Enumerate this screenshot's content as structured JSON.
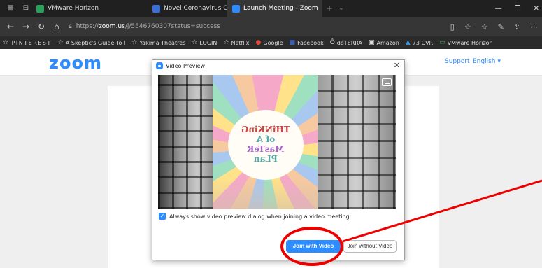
{
  "browser": {
    "tabs": [
      {
        "label": "VMware Horizon",
        "color": "#2aa05a"
      },
      {
        "label": "Novel Coronavirus Outbreal",
        "color": "#3a6fd8"
      },
      {
        "label": "Launch Meeting - Zoom",
        "color": "#2d8cff",
        "active": true
      }
    ],
    "url_prefix": "https://",
    "url_host": "zoom.us",
    "url_path": "/j/5546760307status=success",
    "favorites": [
      {
        "label": "PINTEREST",
        "icon": "star-icon"
      },
      {
        "label": "A Skeptic's Guide To I",
        "icon": "star-icon"
      },
      {
        "label": "Yakima Theatres",
        "icon": "star-icon"
      },
      {
        "label": "LOGIN",
        "icon": "star-icon"
      },
      {
        "label": "Netflix",
        "icon": "star-icon"
      },
      {
        "label": "Google",
        "icon": "google-icon"
      },
      {
        "label": "Facebook",
        "icon": "facebook-icon"
      },
      {
        "label": "doTERRA",
        "icon": "doterra-icon"
      },
      {
        "label": "Amazon",
        "icon": "amazon-icon"
      },
      {
        "label": "73 CVR",
        "icon": "cvr-icon"
      },
      {
        "label": "VMware Horizon",
        "icon": "vmware-icon"
      }
    ]
  },
  "page": {
    "logo": "zoom",
    "support": "Support",
    "language": "English ▾"
  },
  "dialog": {
    "title": "Video Preview",
    "close": "✕",
    "preview_text": [
      "THiNKinG",
      "of A",
      "MasTeR",
      "PLan"
    ],
    "checkbox_label": "Always show video preview dialog when joining a video meeting",
    "checkbox_checked": true,
    "join_with_video": "Join with Video",
    "join_without_video": "Join without Video"
  },
  "colors": {
    "accent": "#2d8cff",
    "annotation": "#e00000"
  }
}
